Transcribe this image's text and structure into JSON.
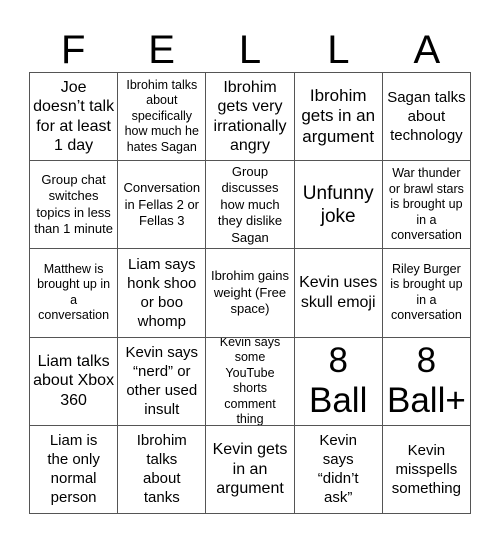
{
  "title_letters": [
    "F",
    "E",
    "L",
    "L",
    "A"
  ],
  "cells": [
    [
      "Joe doesn’t talk for at least 1 day",
      "Ibrohim talks about specifically how much he hates Sagan",
      "Ibrohim gets very irrationally angry",
      "Ibrohim gets in an argument",
      "Sagan talks about technology"
    ],
    [
      "Group chat switches topics in less than 1 minute",
      "Conversation in Fellas 2 or Fellas 3",
      "Group discusses how much they dislike Sagan",
      "Unfunny joke",
      "War thunder or brawl stars is brought up in a conversation"
    ],
    [
      "Matthew is brought up in a conversation",
      "Liam says honk shoo or boo whomp",
      "Ibrohim gains weight (Free space)",
      "Kevin uses skull emoji",
      "Riley Burger is brought up in a conversation"
    ],
    [
      "Liam talks about Xbox 360",
      "Kevin says “nerd” or other used insult",
      "Kevin says some YouTube shorts comment thing",
      "8 Ball",
      "8 Ball+"
    ],
    [
      "Liam is the only normal person",
      "Ibrohim talks about tanks",
      "Kevin gets in an argument",
      "Kevin says “didn’t ask”",
      "Kevin misspells something"
    ]
  ]
}
